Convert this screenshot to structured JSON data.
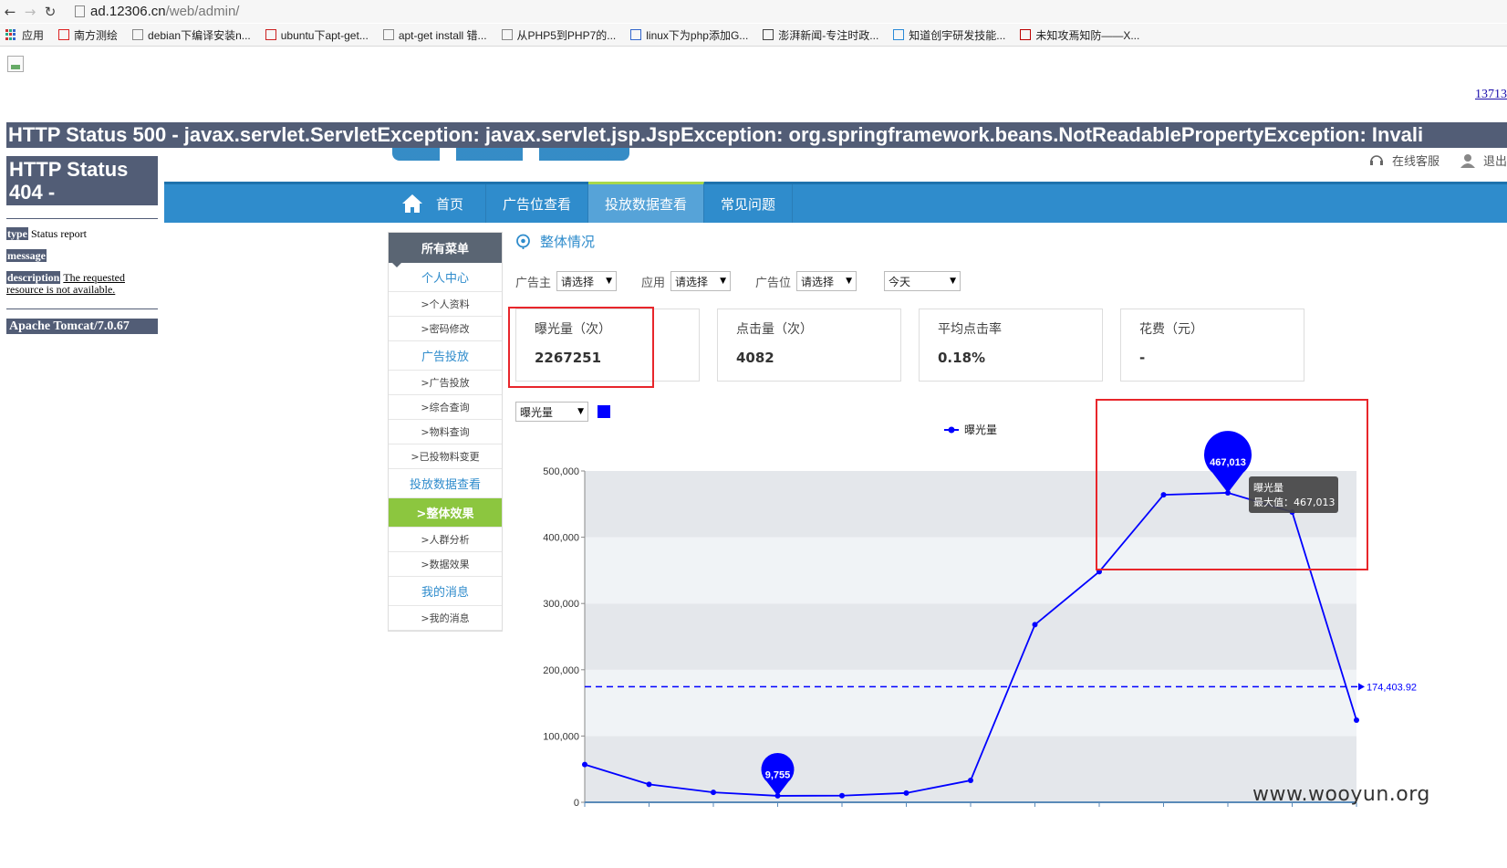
{
  "browser": {
    "url_host": "ad.12306.cn",
    "url_path": "/web/admin/",
    "bookmarks": [
      "应用",
      "南方测绘",
      "debian下编译安装n...",
      "ubuntu下apt-get...",
      "apt-get install 错...",
      "从PHP5到PHP7的...",
      "linux下为php添加G...",
      "澎湃新闻-专注时政...",
      "知道创宇研发技能...",
      "未知攻焉知防——X..."
    ]
  },
  "page": {
    "phone_link": "13713",
    "error500_title": "HTTP Status 500 - javax.servlet.ServletException: javax.servlet.jsp.JspException: org.springframework.beans.NotReadablePropertyException: Invali",
    "error404_title": "HTTP Status 404 -",
    "report": {
      "type_label": "type",
      "type_value": "Status report",
      "message_label": "message",
      "description_label": "description",
      "description_value": "The requested resource is not available."
    },
    "server": "Apache Tomcat/7.0.67"
  },
  "header": {
    "service_label": "在线客服",
    "logout_label": "退出"
  },
  "nav": {
    "items": [
      "首页",
      "广告位查看",
      "投放数据查看",
      "常见问题"
    ],
    "active_index": 2
  },
  "sidebar": {
    "title": "所有菜单",
    "sections": [
      {
        "label": "个人中心",
        "items": [
          ">个人资料",
          ">密码修改"
        ]
      },
      {
        "label": "广告投放",
        "items": [
          ">广告投放",
          ">综合查询",
          ">物料查询",
          ">已投物料变更"
        ]
      },
      {
        "label": "投放数据查看",
        "items": [
          ">整体效果",
          ">人群分析",
          ">数据效果"
        ]
      },
      {
        "label": "我的消息",
        "items": [
          ">我的消息"
        ]
      }
    ],
    "active_item": ">整体效果"
  },
  "content": {
    "title": "整体情况",
    "filters": {
      "advertiser_label": "广告主",
      "advertiser_value": "请选择",
      "app_label": "应用",
      "app_value": "请选择",
      "slot_label": "广告位",
      "slot_value": "请选择",
      "date_value": "今天"
    },
    "stats": [
      {
        "label": "曝光量（次）",
        "value": "2267251"
      },
      {
        "label": "点击量（次）",
        "value": "4082"
      },
      {
        "label": "平均点击率",
        "value": "0.18%"
      },
      {
        "label": "花费（元）",
        "value": "-"
      }
    ],
    "metric_select": "曝光量"
  },
  "chart_data": {
    "type": "line",
    "series": [
      {
        "name": "曝光量",
        "values": [
          57000,
          27000,
          15000,
          9755,
          10000,
          14000,
          33000,
          268000,
          348000,
          464000,
          467013,
          438000,
          124000
        ]
      }
    ],
    "ylim": [
      0,
      500000
    ],
    "y_ticks": [
      "0",
      "100,000",
      "200,000",
      "300,000",
      "400,000",
      "500,000"
    ],
    "average_line": {
      "value": 174403.92,
      "label": "174,403.92"
    },
    "max_marker": {
      "index": 10,
      "label": "467,013"
    },
    "min_marker": {
      "index": 3,
      "label": "9,755"
    },
    "tooltip": {
      "title": "曝光量",
      "text": "最大值：467,013"
    },
    "grid": true,
    "legend_position": "top",
    "colors": {
      "line": "#0000ff",
      "band_dark": "#e4e7eb",
      "band_light": "#f0f3f6"
    }
  },
  "watermark": "www.wooyun.org"
}
